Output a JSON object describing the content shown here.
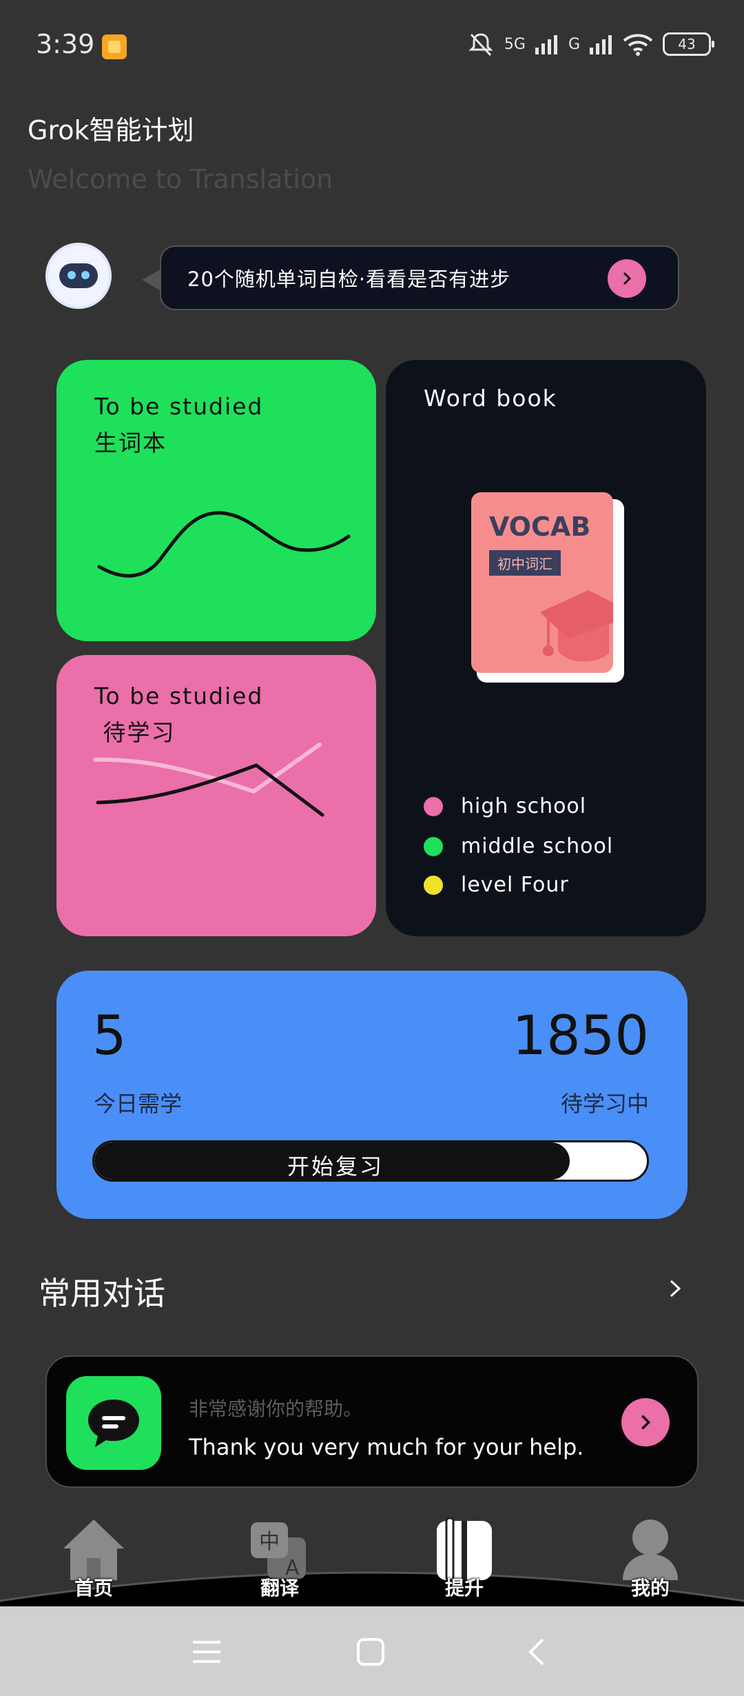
{
  "status_bar": {
    "time": "3:39",
    "net1": "5G",
    "net2": "G",
    "battery": "43"
  },
  "header": {
    "title": "Grok智能计划",
    "subtitle": "Welcome to Translation"
  },
  "prompt": {
    "text": "20个随机单词自检·看看是否有进步"
  },
  "cards": {
    "green": {
      "line1": "To be studied",
      "line2": "生词本",
      "color": "#1ee05b"
    },
    "pink": {
      "line1": "To be studied",
      "line2": " 待学习",
      "color": "#eb6fa9"
    },
    "wordbook": {
      "title": "Word book",
      "book_title": "VOCAB",
      "book_tag": "初中词汇",
      "legend": [
        {
          "label": "high school",
          "color": "#eb6fa9"
        },
        {
          "label": "middle school",
          "color": "#1ee05b"
        },
        {
          "label": "level Four",
          "color": "#f0e12a"
        }
      ]
    }
  },
  "stats": {
    "today_count": "5",
    "today_label": "今日需学",
    "pending_count": "1850",
    "pending_label": "待学习中",
    "review_button": "开始复习",
    "progress_fraction": 0.86,
    "color": "#4a8ff7"
  },
  "conversation": {
    "section_title": "常用对话",
    "zh": "非常感谢你的帮助。",
    "en": "Thank you very much for your help."
  },
  "nav": {
    "items": [
      {
        "label": "首页",
        "icon": "home-icon"
      },
      {
        "label": "翻译",
        "icon": "translate-icon"
      },
      {
        "label": "提升",
        "icon": "book-icon",
        "active": true
      },
      {
        "label": "我的",
        "icon": "profile-icon"
      }
    ]
  },
  "system_nav": {
    "icons": [
      "menu-icon",
      "home-square-icon",
      "back-icon"
    ]
  }
}
